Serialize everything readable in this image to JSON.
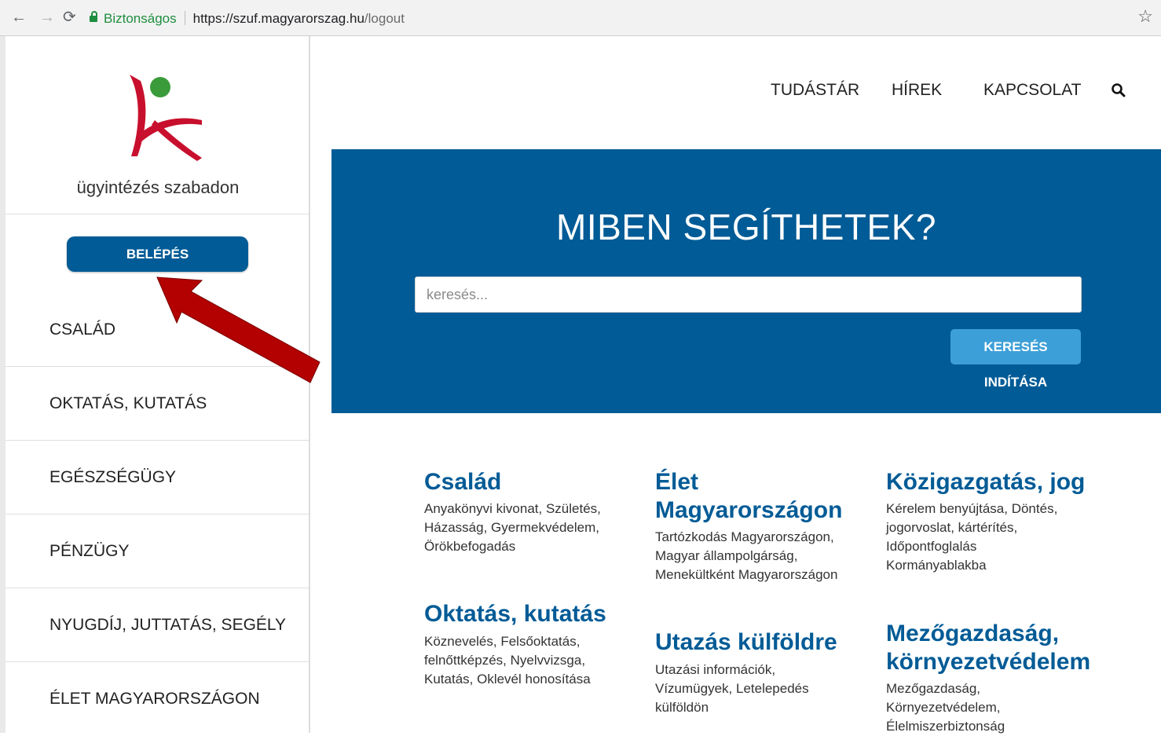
{
  "browser": {
    "secure_label": "Biztonságos",
    "url_main": "https://szuf.magyarorszag.hu",
    "url_path": "/logout",
    "nav_icons": [
      "back-icon",
      "forward-icon",
      "reload-icon",
      "bookmark-star-icon"
    ]
  },
  "sidebar": {
    "tagline": "ügyintézés szabadon",
    "login_label": "BELÉPÉS",
    "items": [
      {
        "label": "CSALÁD"
      },
      {
        "label": "OKTATÁS, KUTATÁS"
      },
      {
        "label": "EGÉSZSÉGÜGY"
      },
      {
        "label": "PÉNZÜGY"
      },
      {
        "label": "NYUGDÍJ, JUTTATÁS, SEGÉLY"
      },
      {
        "label": "ÉLET MAGYARORSZÁGON"
      }
    ]
  },
  "top_nav": {
    "items": [
      {
        "label": "TUDÁSTÁR"
      },
      {
        "label": "HÍREK"
      },
      {
        "label": "KAPCSOLAT"
      }
    ]
  },
  "hero": {
    "title": "MIBEN SEGÍTHETEK?",
    "search_placeholder": "keresés...",
    "search_button": "KERESÉS INDÍTÁSA"
  },
  "categories": [
    {
      "title": "Család",
      "desc_lines": [
        "Anyakönyvi kivonat, Születés,",
        "Házasság, Gyermekvédelem,",
        "Örökbefogadás"
      ]
    },
    {
      "title_lines": [
        "Élet",
        "Magyarországon"
      ],
      "desc_lines": [
        "Tartózkodás Magyarországon,",
        "Magyar állampolgárság,",
        "Menekültként Magyarországon"
      ]
    },
    {
      "title": "Közigazgatás, jog",
      "desc_lines": [
        "Kérelem benyújtása, Döntés,",
        "jogorvoslat, kártérítés,",
        "Időpontfoglalás",
        "Kormányablakba"
      ]
    },
    {
      "title": "Oktatás, kutatás",
      "desc_lines": [
        "Köznevelés, Felsőoktatás,",
        "felnőttképzés, Nyelvvizsga,",
        "Kutatás, Oklevél honosítása"
      ]
    },
    {
      "title": "Utazás külföldre",
      "desc_lines": [
        "Utazási információk,",
        "Vízumügyek, Letelepedés",
        "külföldön"
      ]
    },
    {
      "title_lines": [
        "Mezőgazdaság,",
        "környezetvédelem"
      ],
      "desc_lines": [
        "Mezőgazdaság,",
        "Környezetvédelem,",
        "Élelmiszerbiztonság"
      ]
    }
  ],
  "colors": {
    "brand_blue": "#005b96",
    "button_light_blue": "#3d9fd8",
    "logo_red": "#c8102e",
    "logo_green": "#3a9b3a",
    "annotation_arrow": "#b30000"
  }
}
